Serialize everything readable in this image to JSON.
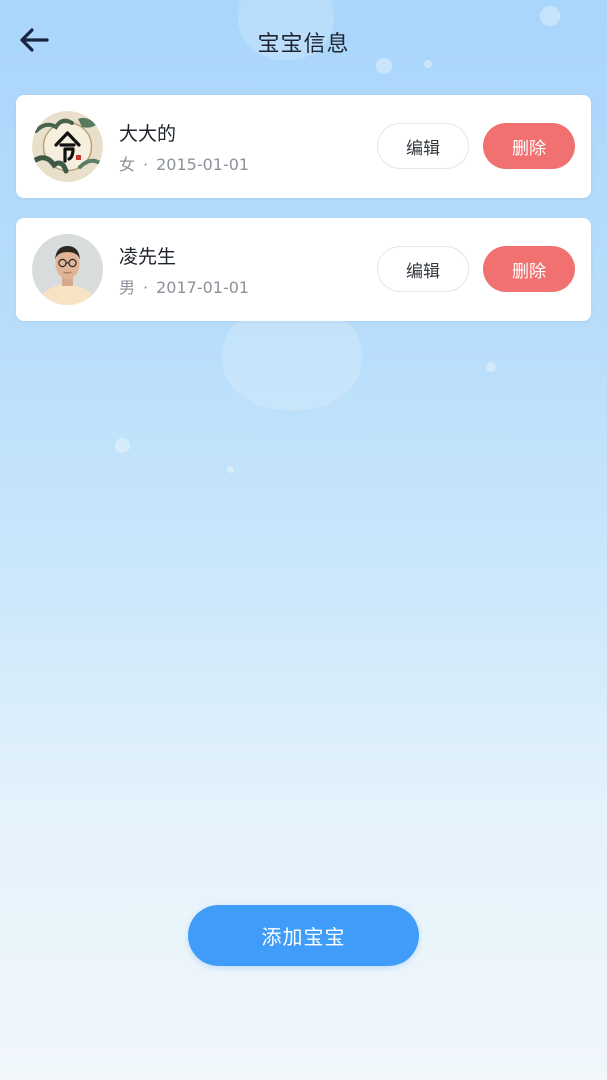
{
  "header": {
    "title": "宝宝信息",
    "back_icon": "arrow-left-icon"
  },
  "babies": [
    {
      "name": "大大的",
      "gender": "女",
      "separator": "·",
      "birthdate": "2015-01-01",
      "avatar": "ink-painting-avatar",
      "edit_label": "编辑",
      "delete_label": "删除"
    },
    {
      "name": "凌先生",
      "gender": "男",
      "separator": "·",
      "birthdate": "2017-01-01",
      "avatar": "person-photo-avatar",
      "edit_label": "编辑",
      "delete_label": "删除"
    }
  ],
  "footer": {
    "add_label": "添加宝宝"
  },
  "colors": {
    "delete_button": "#f0716f",
    "add_button": "#3f9cf8",
    "title_text": "#1f2530",
    "meta_text": "#8d929a"
  }
}
